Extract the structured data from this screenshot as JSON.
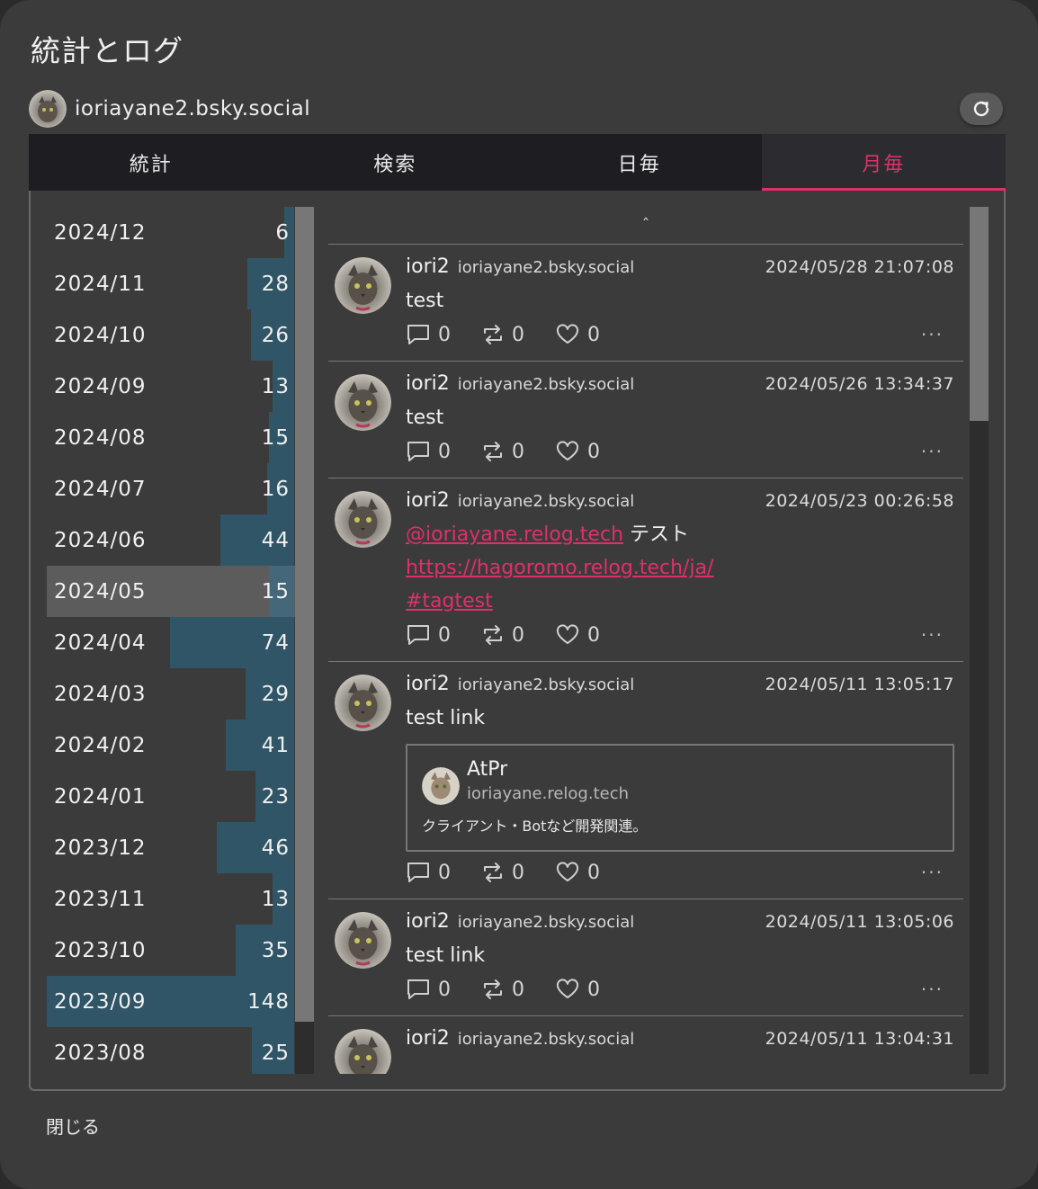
{
  "dialog": {
    "title": "統計とログ",
    "account_handle": "ioriayane2.bsky.social",
    "close_label": "閉じる"
  },
  "tabs": [
    {
      "label": "統計",
      "active": false
    },
    {
      "label": "検索",
      "active": false
    },
    {
      "label": "日毎",
      "active": false
    },
    {
      "label": "月毎",
      "active": true
    }
  ],
  "months": [
    {
      "label": "2024/12",
      "count": "6",
      "value": 6
    },
    {
      "label": "2024/11",
      "count": "28",
      "value": 28
    },
    {
      "label": "2024/10",
      "count": "26",
      "value": 26
    },
    {
      "label": "2024/09",
      "count": "13",
      "value": 13
    },
    {
      "label": "2024/08",
      "count": "15",
      "value": 15
    },
    {
      "label": "2024/07",
      "count": "16",
      "value": 16
    },
    {
      "label": "2024/06",
      "count": "44",
      "value": 44
    },
    {
      "label": "2024/05",
      "count": "15",
      "value": 15,
      "selected": true
    },
    {
      "label": "2024/04",
      "count": "74",
      "value": 74
    },
    {
      "label": "2024/03",
      "count": "29",
      "value": 29
    },
    {
      "label": "2024/02",
      "count": "41",
      "value": 41
    },
    {
      "label": "2024/01",
      "count": "23",
      "value": 23
    },
    {
      "label": "2023/12",
      "count": "46",
      "value": 46
    },
    {
      "label": "2023/11",
      "count": "13",
      "value": 13
    },
    {
      "label": "2023/10",
      "count": "35",
      "value": 35
    },
    {
      "label": "2023/09",
      "count": "148",
      "value": 148
    },
    {
      "label": "2023/08",
      "count": "25",
      "value": 25
    }
  ],
  "feed": {
    "up_arrow": "ˆ",
    "posts": [
      {
        "name": "iori2",
        "handle": "ioriayane2.bsky.social",
        "time": "2024/05/28 21:07:08",
        "text": "test",
        "replies": "0",
        "reposts": "0",
        "likes": "0"
      },
      {
        "name": "iori2",
        "handle": "ioriayane2.bsky.social",
        "time": "2024/05/26 13:34:37",
        "text": "test",
        "replies": "0",
        "reposts": "0",
        "likes": "0"
      },
      {
        "name": "iori2",
        "handle": "ioriayane2.bsky.social",
        "time": "2024/05/23 00:26:58",
        "mention": "@ioriayane.relog.tech",
        "mention_suffix": " テスト",
        "url": "https://hagoromo.relog.tech/ja/",
        "hashtag": "#tagtest",
        "replies": "0",
        "reposts": "0",
        "likes": "0"
      },
      {
        "name": "iori2",
        "handle": "ioriayane2.bsky.social",
        "time": "2024/05/11 13:05:17",
        "text": "test link",
        "card": {
          "title": "AtPr",
          "handle": "ioriayane.relog.tech",
          "description": "クライアント・Botなど開発関連。"
        },
        "replies": "0",
        "reposts": "0",
        "likes": "0"
      },
      {
        "name": "iori2",
        "handle": "ioriayane2.bsky.social",
        "time": "2024/05/11 13:05:06",
        "text": "test link",
        "replies": "0",
        "reposts": "0",
        "likes": "0"
      },
      {
        "name": "iori2",
        "handle": "ioriayane2.bsky.social",
        "time": "2024/05/11 13:04:31"
      }
    ]
  },
  "colors": {
    "accent": "#e0306a",
    "bar": "#2f5566",
    "background": "#3b3b3b"
  }
}
